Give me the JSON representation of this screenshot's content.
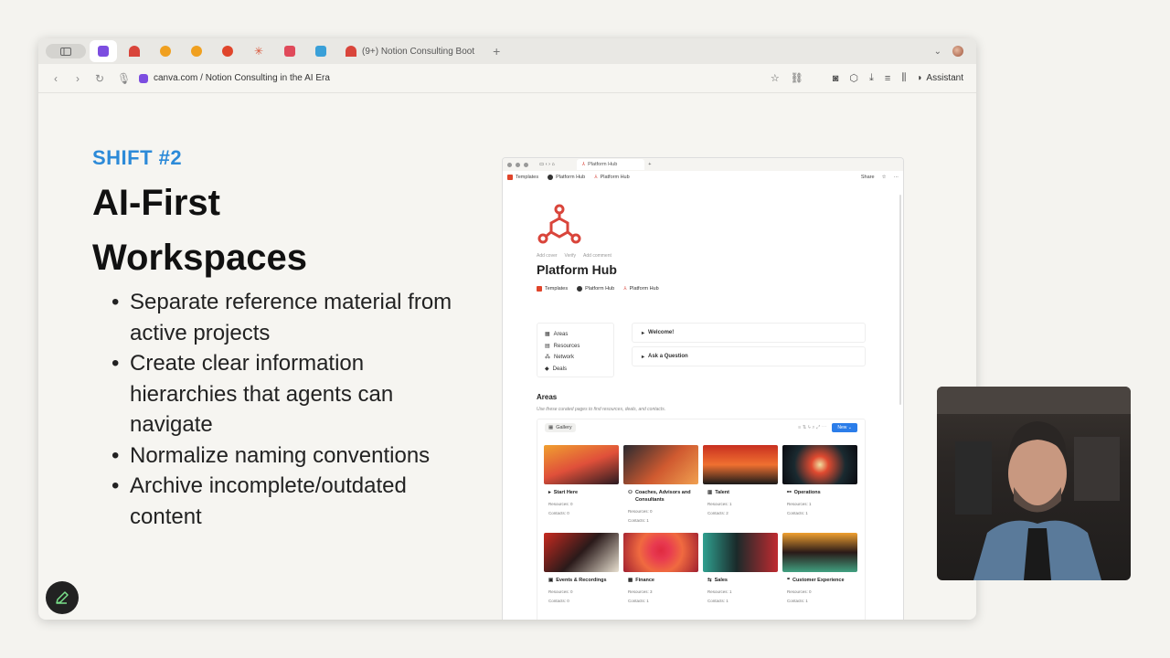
{
  "browser": {
    "tab_title": "(9+) Notion Consulting Boot",
    "url": "canva.com / Notion Consulting in the AI Era",
    "assistant_label": "Assistant"
  },
  "slide": {
    "eyebrow": "SHIFT #2",
    "title_line1": "AI-First",
    "title_line2": "Workspaces",
    "bullets": [
      "Separate reference material from active projects",
      "Create clear information hierarchies that agents can navigate",
      "Normalize naming conventions",
      "Archive incomplete/outdated content"
    ]
  },
  "notion": {
    "tab_title": "Platform Hub",
    "breadcrumbs": [
      "Templates",
      "Platform Hub",
      "Platform Hub"
    ],
    "share_label": "Share",
    "meta": [
      "Add cover",
      "Verify",
      "Add comment"
    ],
    "page_title": "Platform Hub",
    "props": [
      "Templates",
      "Platform Hub",
      "Platform Hub"
    ],
    "nav": [
      "Areas",
      "Resources",
      "Network",
      "Deals"
    ],
    "toggles": [
      "Welcome!",
      "Ask a Question"
    ],
    "areas_heading": "Areas",
    "areas_sub": "Use these curated pages to find resources, deals, and contacts.",
    "gallery_label": "Gallery",
    "new_label": "New",
    "cards": [
      {
        "title": "Start Here",
        "resources": "Resources: 0",
        "contacts": "Contacts: 0"
      },
      {
        "title": "Coaches, Advisors and Consultants",
        "resources": "Resources: 0",
        "contacts": "Contacts: 1"
      },
      {
        "title": "Talent",
        "resources": "Resources: 1",
        "contacts": "Contacts: 2"
      },
      {
        "title": "Operations",
        "resources": "Resources: 1",
        "contacts": "Contacts: 1"
      },
      {
        "title": "Events & Recordings",
        "resources": "Resources: 0",
        "contacts": "Contacts: 0"
      },
      {
        "title": "Finance",
        "resources": "Resources: 3",
        "contacts": "Contacts: 1"
      },
      {
        "title": "Sales",
        "resources": "Resources: 1",
        "contacts": "Contacts: 1"
      },
      {
        "title": "Customer Experience",
        "resources": "Resources: 0",
        "contacts": "Contacts: 1"
      }
    ]
  }
}
